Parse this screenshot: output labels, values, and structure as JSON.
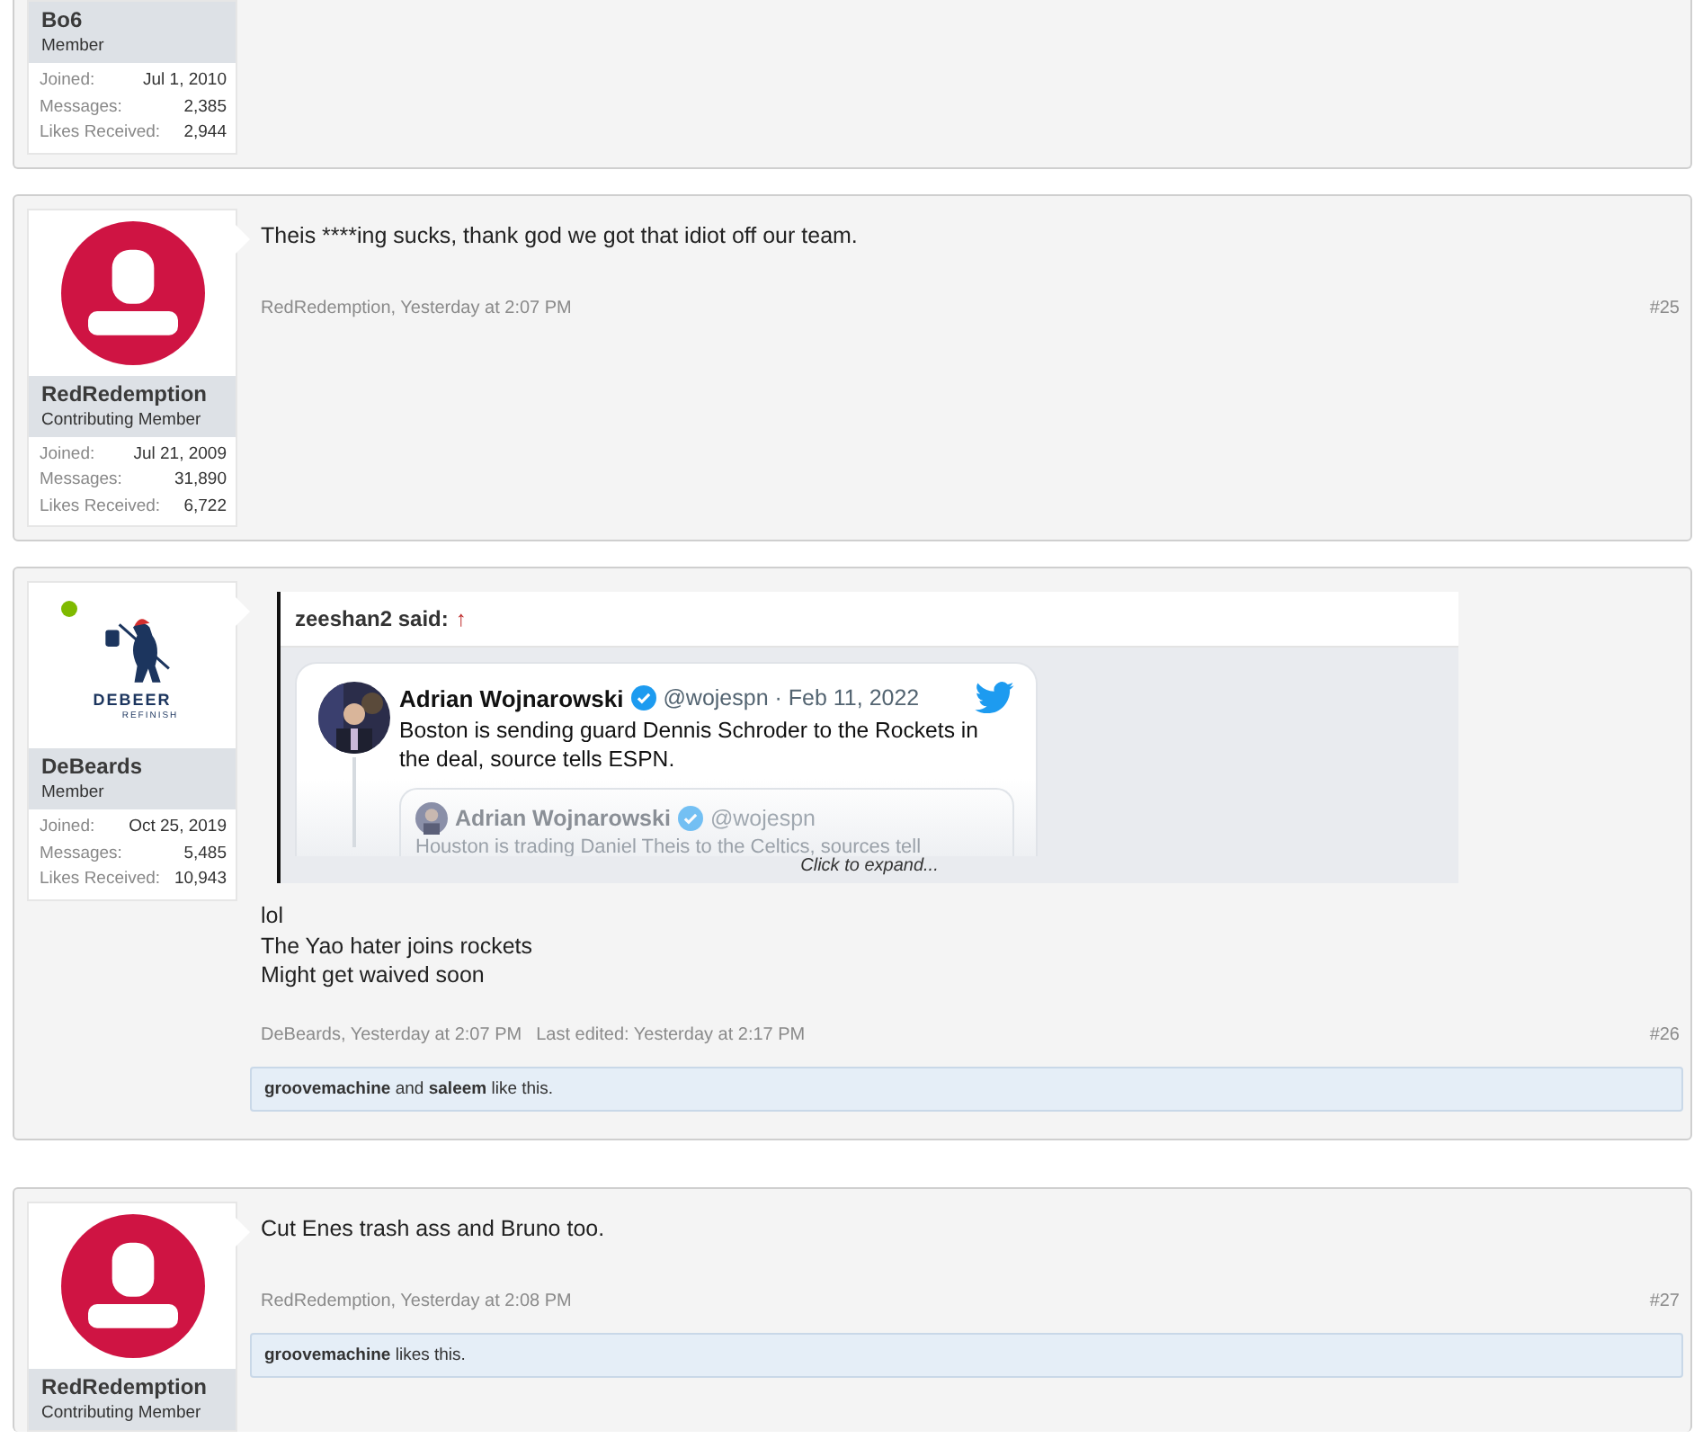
{
  "posts": [
    {
      "user": {
        "name": "Bo6",
        "title": "Member",
        "online": false,
        "stats": [
          {
            "label": "Joined:",
            "value": "Jul 1, 2010"
          },
          {
            "label": "Messages:",
            "value": "2,385"
          },
          {
            "label": "Likes Received:",
            "value": "2,944"
          }
        ]
      }
    },
    {
      "user": {
        "name": "RedRedemption",
        "title": "Contributing Member",
        "online": false,
        "avatar": {
          "kind": "default"
        },
        "stats": [
          {
            "label": "Joined:",
            "value": "Jul 21, 2009"
          },
          {
            "label": "Messages:",
            "value": "31,890"
          },
          {
            "label": "Likes Received:",
            "value": "6,722"
          }
        ]
      },
      "message": [
        "Theis ****ing sucks, thank god we got that idiot off our team."
      ],
      "meta": {
        "author_time": "RedRedemption, Yesterday at 2:07 PM",
        "number": "#25"
      }
    },
    {
      "user": {
        "name": "DeBeards",
        "title": "Member",
        "online": true,
        "avatar": {
          "kind": "logo",
          "brand": "DEBEER",
          "tagline": "REFINISH"
        },
        "stats": [
          {
            "label": "Joined:",
            "value": "Oct 25, 2019"
          },
          {
            "label": "Messages:",
            "value": "5,485"
          },
          {
            "label": "Likes Received:",
            "value": "10,943"
          }
        ]
      },
      "quote": {
        "author": "zeeshan2 said:",
        "arrow": "↑",
        "tweet": {
          "name": "Adrian Wojnarowski",
          "handle_date": "@wojespn · Feb 11, 2022",
          "text": "Boston is sending guard Dennis Schroder to the Rockets in the deal, source tells ESPN.",
          "quoted": {
            "name": "Adrian Wojnarowski",
            "handle": "@wojespn",
            "text": "Houston is trading Daniel Theis to the Celtics, sources tell"
          }
        },
        "expand": "Click to expand..."
      },
      "message": [
        "lol",
        "The Yao hater joins rockets",
        "Might get waived soon"
      ],
      "meta": {
        "author_time": "DeBeards, Yesterday at 2:07 PM",
        "edited": "Last edited: Yesterday at 2:17 PM",
        "number": "#26"
      },
      "likes": "**groovemachine** and **saleem** like this."
    },
    {
      "user": {
        "name": "RedRedemption",
        "title": "Contributing Member",
        "online": false,
        "avatar": {
          "kind": "default"
        }
      },
      "message": [
        "Cut Enes trash ass and Bruno too."
      ],
      "meta": {
        "author_time": "RedRedemption, Yesterday at 2:08 PM",
        "number": "#27"
      },
      "likes": "**groovemachine** likes this."
    }
  ]
}
